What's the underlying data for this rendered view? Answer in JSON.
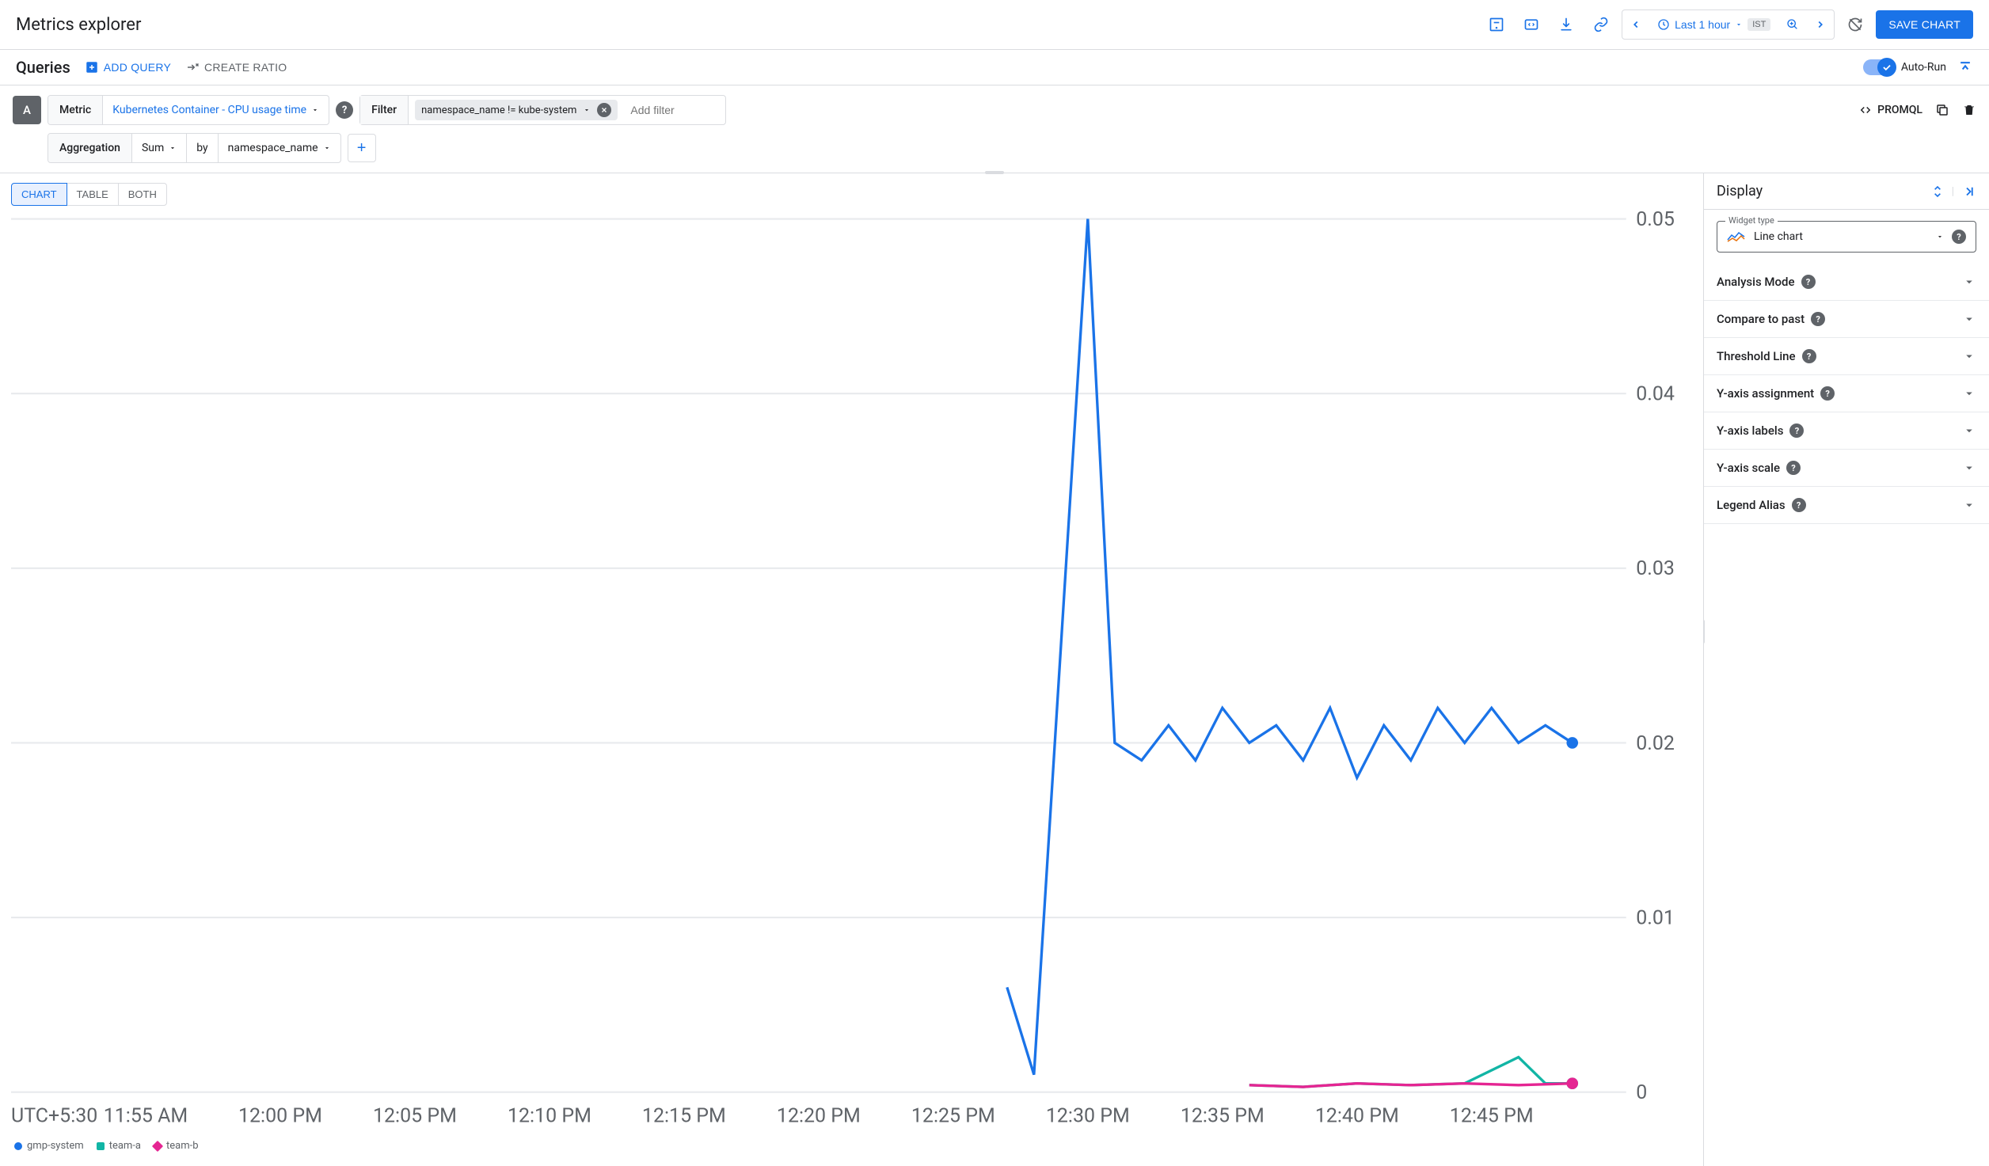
{
  "header": {
    "title": "Metrics explorer",
    "time_range": "Last 1 hour",
    "timezone_badge": "IST",
    "save_button": "SAVE CHART"
  },
  "queries_bar": {
    "title": "Queries",
    "add_query": "ADD QUERY",
    "create_ratio": "CREATE RATIO",
    "auto_run": "Auto-Run"
  },
  "query": {
    "letter": "A",
    "metric_label": "Metric",
    "metric_value": "Kubernetes Container - CPU usage time",
    "filter_label": "Filter",
    "filter_chip": "namespace_name != kube-system",
    "add_filter_placeholder": "Add filter",
    "aggregation_label": "Aggregation",
    "aggregation_func": "Sum",
    "aggregation_by": "by",
    "aggregation_group": "namespace_name",
    "promql": "PROMQL"
  },
  "view_tabs": {
    "chart": "CHART",
    "table": "TABLE",
    "both": "BOTH"
  },
  "display_panel": {
    "title": "Display",
    "widget_type_label": "Widget type",
    "widget_type_value": "Line chart",
    "sections": {
      "analysis_mode": "Analysis Mode",
      "compare_past": "Compare to past",
      "threshold_line": "Threshold Line",
      "yaxis_assignment": "Y-axis assignment",
      "yaxis_labels": "Y-axis labels",
      "yaxis_scale": "Y-axis scale",
      "legend_alias": "Legend Alias"
    }
  },
  "legend": {
    "gmp_system": "gmp-system",
    "team_a": "team-a",
    "team_b": "team-b"
  },
  "axis": {
    "tz_label": "UTC+5:30"
  },
  "chart_data": {
    "type": "line",
    "ylim": [
      0,
      0.05
    ],
    "y_ticks": [
      0,
      0.01,
      0.02,
      0.03,
      0.04,
      0.05
    ],
    "x_ticks": [
      "11:55 AM",
      "12:00 PM",
      "12:05 PM",
      "12:10 PM",
      "12:15 PM",
      "12:20 PM",
      "12:25 PM",
      "12:30 PM",
      "12:35 PM",
      "12:40 PM",
      "12:45 PM"
    ],
    "series": [
      {
        "name": "gmp-system",
        "color": "#1a73e8",
        "points": [
          {
            "t": "12:27 PM",
            "v": 0.006
          },
          {
            "t": "12:28 PM",
            "v": 0.001
          },
          {
            "t": "12:30 PM",
            "v": 0.05
          },
          {
            "t": "12:31 PM",
            "v": 0.02
          },
          {
            "t": "12:32 PM",
            "v": 0.019
          },
          {
            "t": "12:33 PM",
            "v": 0.021
          },
          {
            "t": "12:34 PM",
            "v": 0.019
          },
          {
            "t": "12:35 PM",
            "v": 0.022
          },
          {
            "t": "12:36 PM",
            "v": 0.02
          },
          {
            "t": "12:37 PM",
            "v": 0.021
          },
          {
            "t": "12:38 PM",
            "v": 0.019
          },
          {
            "t": "12:39 PM",
            "v": 0.022
          },
          {
            "t": "12:40 PM",
            "v": 0.018
          },
          {
            "t": "12:41 PM",
            "v": 0.021
          },
          {
            "t": "12:42 PM",
            "v": 0.019
          },
          {
            "t": "12:43 PM",
            "v": 0.022
          },
          {
            "t": "12:44 PM",
            "v": 0.02
          },
          {
            "t": "12:45 PM",
            "v": 0.022
          },
          {
            "t": "12:46 PM",
            "v": 0.02
          },
          {
            "t": "12:47 PM",
            "v": 0.021
          },
          {
            "t": "12:48 PM",
            "v": 0.02
          }
        ]
      },
      {
        "name": "team-a",
        "color": "#12b5a5",
        "points": [
          {
            "t": "12:36 PM",
            "v": 0.0004
          },
          {
            "t": "12:38 PM",
            "v": 0.0003
          },
          {
            "t": "12:40 PM",
            "v": 0.0005
          },
          {
            "t": "12:42 PM",
            "v": 0.0004
          },
          {
            "t": "12:44 PM",
            "v": 0.0005
          },
          {
            "t": "12:46 PM",
            "v": 0.002
          },
          {
            "t": "12:47 PM",
            "v": 0.0005
          },
          {
            "t": "12:48 PM",
            "v": 0.0005
          }
        ]
      },
      {
        "name": "team-b",
        "color": "#e52592",
        "points": [
          {
            "t": "12:36 PM",
            "v": 0.0004
          },
          {
            "t": "12:38 PM",
            "v": 0.0003
          },
          {
            "t": "12:40 PM",
            "v": 0.0005
          },
          {
            "t": "12:42 PM",
            "v": 0.0004
          },
          {
            "t": "12:44 PM",
            "v": 0.0005
          },
          {
            "t": "12:46 PM",
            "v": 0.0004
          },
          {
            "t": "12:48 PM",
            "v": 0.0005
          }
        ]
      }
    ]
  }
}
